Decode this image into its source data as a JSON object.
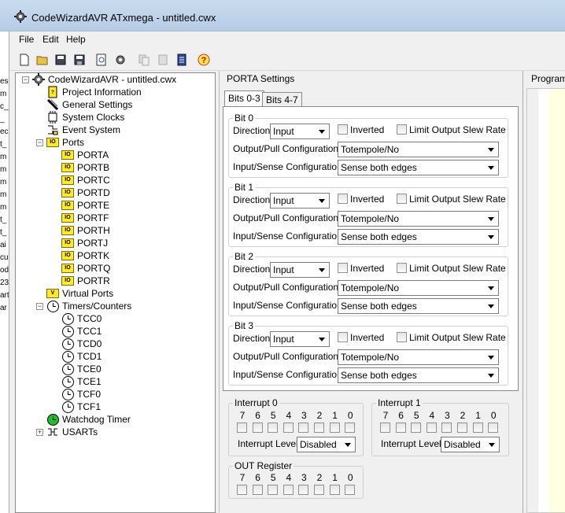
{
  "window": {
    "title": "CodeWizardAVR ATxmega - untitled.cwx"
  },
  "left_strip": [
    "es",
    "m",
    "c_",
    "_",
    "ec",
    "t_",
    "m",
    "m",
    "m",
    "m",
    "m",
    "t_",
    "t_",
    "ai",
    "cu",
    "od",
    "23",
    "art",
    "ar"
  ],
  "menu": [
    "File",
    "Edit",
    "Help"
  ],
  "toolbar": [
    "new-icon",
    "open-icon",
    "save-icon",
    "save-all-icon",
    "preview-icon",
    "generate-icon",
    "copy-icon",
    "paste-icon",
    "notes-icon",
    "help-icon"
  ],
  "tree": {
    "root": "CodeWizardAVR - untitled.cwx",
    "items": [
      "Project Information",
      "General Settings",
      "System Clocks",
      "Event System",
      "Ports"
    ],
    "ports": [
      "PORTA",
      "PORTB",
      "PORTC",
      "PORTD",
      "PORTE",
      "PORTF",
      "PORTH",
      "PORTJ",
      "PORTK",
      "PORTQ",
      "PORTR"
    ],
    "virtual_ports": "Virtual Ports",
    "timers": "Timers/Counters",
    "timer_items": [
      "TCC0",
      "TCC1",
      "TCD0",
      "TCD1",
      "TCE0",
      "TCE1",
      "TCF0",
      "TCF1"
    ],
    "watchdog": "Watchdog Timer",
    "usarts": "USARTs"
  },
  "panel": {
    "title": "PORTA Settings",
    "right_title": "Program P"
  },
  "tabs": [
    "Bits 0-3",
    "Bits 4-7"
  ],
  "labels": {
    "direction": "Direction:",
    "inverted": "Inverted",
    "limit": "Limit Output Slew Rate",
    "output_pull": "Output/Pull Configuration:",
    "input_sense": "Input/Sense Configuration:",
    "interrupt_level": "Interrupt Level:"
  },
  "bits": [
    {
      "title": "Bit 0",
      "direction": "Input",
      "output_pull": "Totempole/No",
      "input_sense": "Sense both edges"
    },
    {
      "title": "Bit 1",
      "direction": "Input",
      "output_pull": "Totempole/No",
      "input_sense": "Sense both edges"
    },
    {
      "title": "Bit 2",
      "direction": "Input",
      "output_pull": "Totempole/No",
      "input_sense": "Sense both edges"
    },
    {
      "title": "Bit 3",
      "direction": "Input",
      "output_pull": "Totempole/No",
      "input_sense": "Sense both edges"
    }
  ],
  "interrupt0": {
    "title": "Interrupt 0",
    "level": "Disabled"
  },
  "interrupt1": {
    "title": "Interrupt 1",
    "level": "Disabled"
  },
  "out_register": {
    "title": "OUT Register"
  },
  "bit_numbers": [
    "7",
    "6",
    "5",
    "4",
    "3",
    "2",
    "1",
    "0"
  ]
}
